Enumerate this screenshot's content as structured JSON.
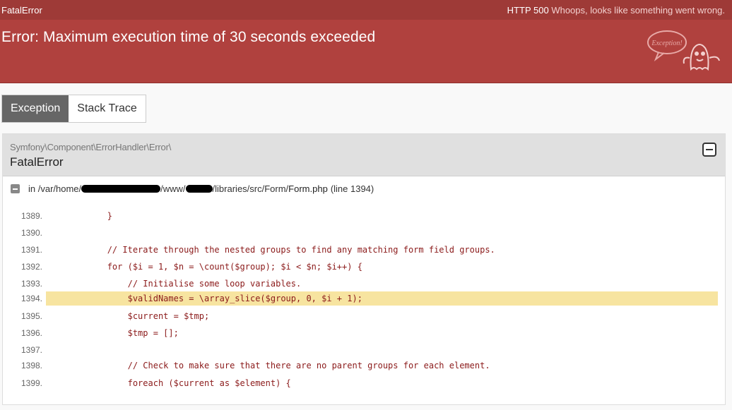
{
  "topbar": {
    "left": "FatalError",
    "status_code": "HTTP 500",
    "status_msg": "Whoops, looks like something went wrong."
  },
  "header": {
    "title": "Error: Maximum execution time of 30 seconds exceeded",
    "badge_text": "Exception!"
  },
  "tabs": [
    {
      "label": "Exception"
    },
    {
      "label": "Stack Trace"
    }
  ],
  "panel": {
    "namespace": "Symfony\\Component\\ErrorHandler\\Error\\",
    "class": "FatalError",
    "file_prefix": "in /var/home/",
    "file_mid1": "/www/",
    "file_mid2": "/libraries/src/Form/",
    "file_name": "Form.php",
    "file_line": "(line 1394)"
  },
  "code": {
    "lines": [
      {
        "num": "1389.",
        "text": "            }",
        "kind": "plain"
      },
      {
        "num": "1390.",
        "text": "",
        "kind": "plain"
      },
      {
        "num": "1391.",
        "text": "            // Iterate through the nested groups to find any matching form field groups.",
        "kind": "comment"
      },
      {
        "num": "1392.",
        "text": "            for ($i = 1, $n = \\count($group); $i < $n; $i++) {",
        "kind": "code"
      },
      {
        "num": "1393.",
        "text": "                // Initialise some loop variables.",
        "kind": "comment"
      },
      {
        "num": "1394.",
        "text": "                $validNames = \\array_slice($group, 0, $i + 1);",
        "kind": "code",
        "highlight": true
      },
      {
        "num": "1395.",
        "text": "                $current = $tmp;",
        "kind": "code"
      },
      {
        "num": "1396.",
        "text": "                $tmp = [];",
        "kind": "code"
      },
      {
        "num": "1397.",
        "text": "",
        "kind": "plain"
      },
      {
        "num": "1398.",
        "text": "                // Check to make sure that there are no parent groups for each element.",
        "kind": "comment"
      },
      {
        "num": "1399.",
        "text": "                foreach ($current as $element) {",
        "kind": "code"
      }
    ]
  },
  "colors": {
    "topbar": "#9e3a37",
    "header": "#b0413e",
    "highlight": "#f7e4a0"
  }
}
